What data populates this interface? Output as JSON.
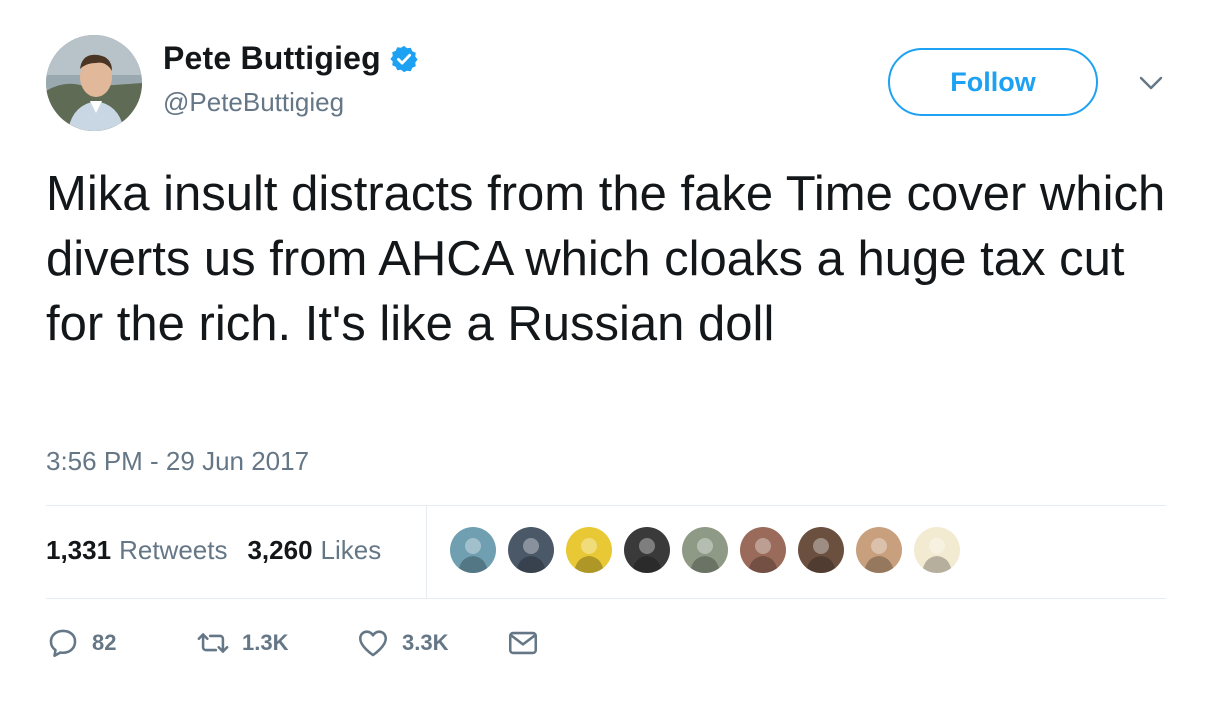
{
  "author": {
    "display_name": "Pete Buttigieg",
    "handle": "@PeteButtigieg",
    "verified": true,
    "avatar_icon": "profile-photo"
  },
  "follow_label": "Follow",
  "tweet": {
    "text": "Mika insult distracts from the fake Time cover which diverts us from AHCA which cloaks a huge tax cut for the rich. It's like a Russian doll",
    "timestamp": "3:56 PM - 29 Jun 2017"
  },
  "stats": {
    "retweets_count": "1,331",
    "retweets_label": "Retweets",
    "likes_count": "3,260",
    "likes_label": "Likes"
  },
  "likers": [
    {
      "icon": "liker-avatar",
      "color": "#6f9fb0"
    },
    {
      "icon": "liker-avatar",
      "color": "#4a5868"
    },
    {
      "icon": "liker-avatar",
      "color": "#e8c935"
    },
    {
      "icon": "liker-avatar",
      "color": "#3a3a3a"
    },
    {
      "icon": "liker-avatar",
      "color": "#8e9a86"
    },
    {
      "icon": "liker-avatar",
      "color": "#9a6b5a"
    },
    {
      "icon": "liker-avatar",
      "color": "#6b5040"
    },
    {
      "icon": "liker-avatar",
      "color": "#c8a07e"
    },
    {
      "icon": "liker-avatar",
      "color": "#f3ead2"
    }
  ],
  "actions": {
    "replies": "82",
    "retweets": "1.3K",
    "likes": "3.3K"
  },
  "colors": {
    "accent": "#1da1f2",
    "text": "#14171a",
    "muted": "#657786",
    "divider": "#e6ecf0"
  }
}
